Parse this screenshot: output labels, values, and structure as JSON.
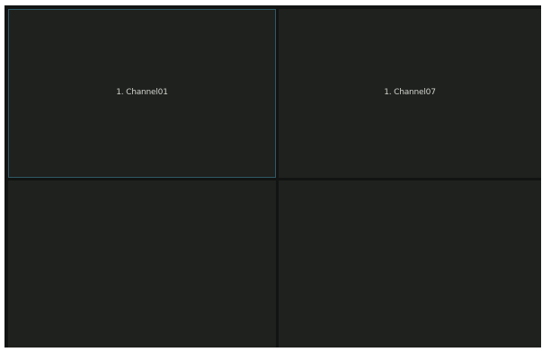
{
  "channels": [
    {
      "label": "1. Channel01",
      "selected": true
    },
    {
      "label": "1. Channel07",
      "selected": false
    },
    {
      "label": "",
      "selected": false
    },
    {
      "label": "",
      "selected": false
    }
  ],
  "colors": {
    "background": "#121413",
    "tile": "#1f211e",
    "selected_border": "#2f5a66",
    "label_text": "#cfd2cc"
  }
}
